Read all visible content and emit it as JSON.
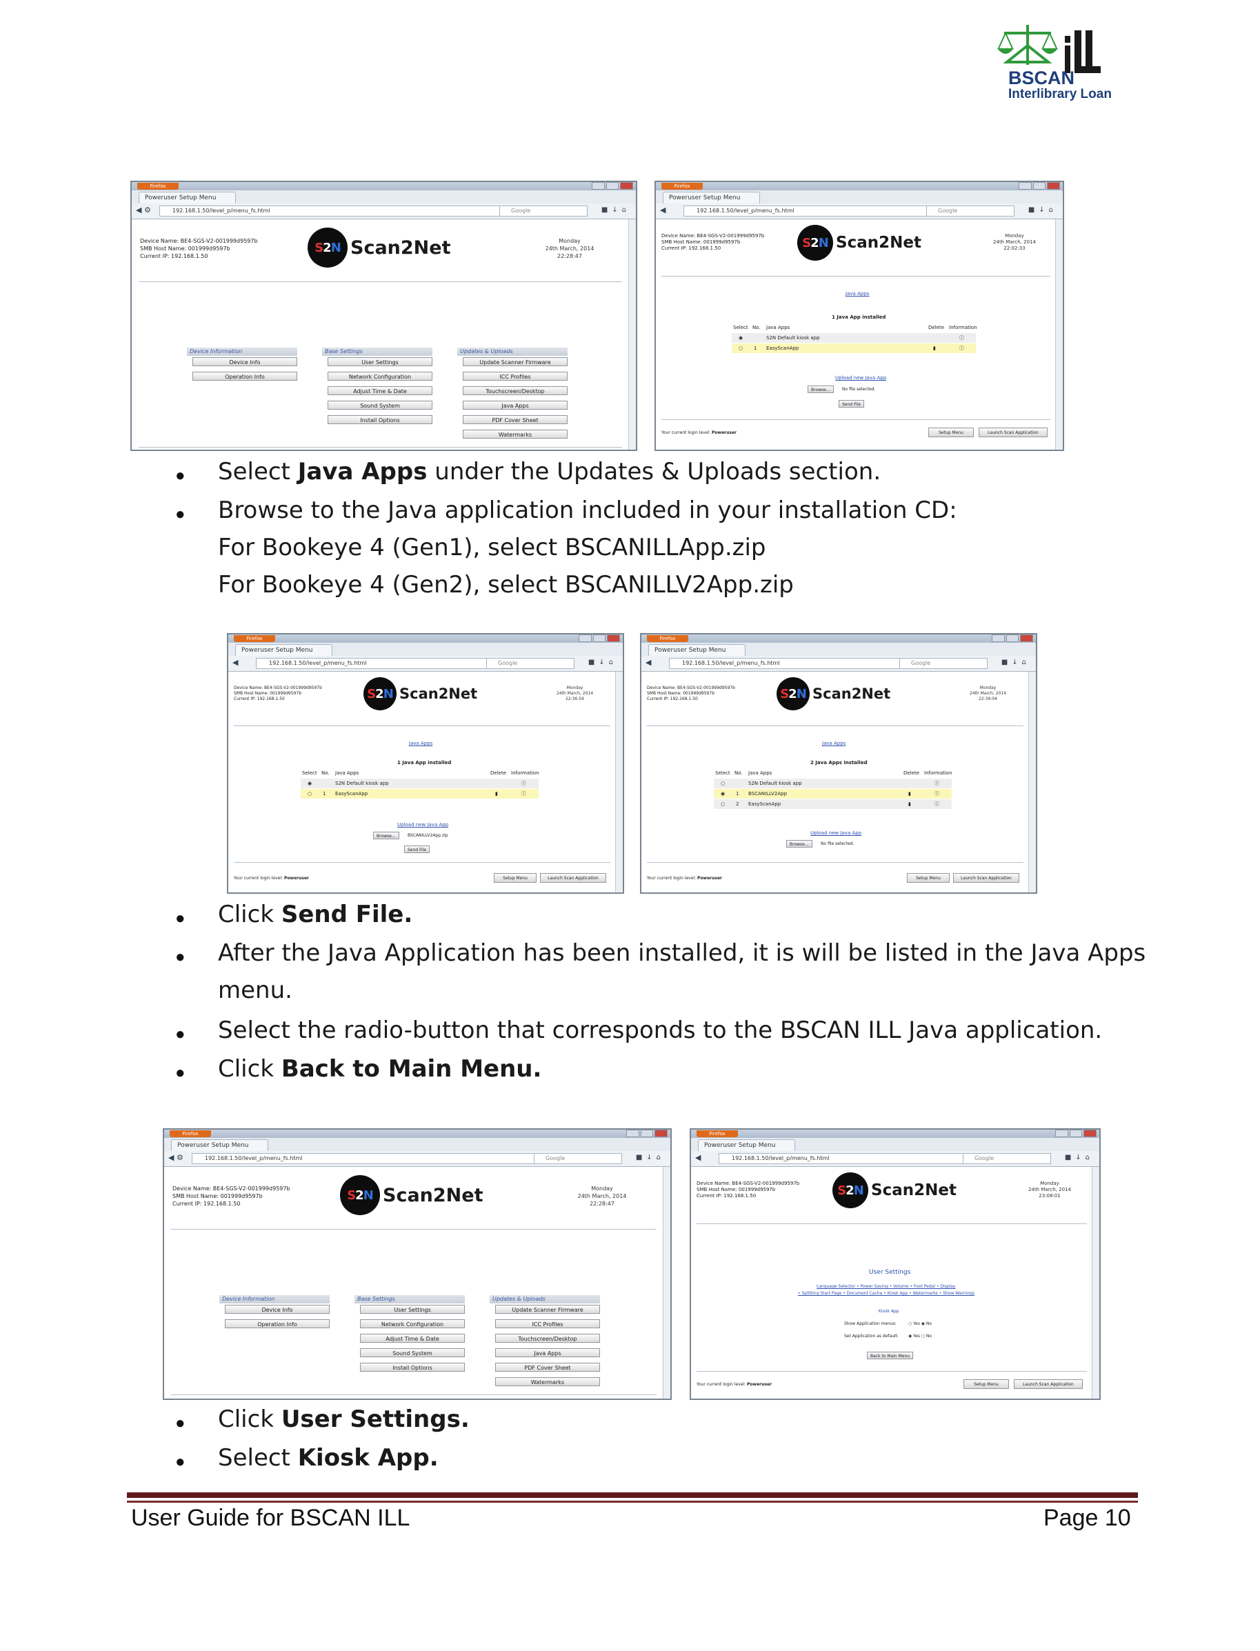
{
  "logo": {
    "brand": "BSCAN",
    "ill": "iLL",
    "subtitle": "Interlibrary Loan"
  },
  "browser": {
    "app_button": "Firefox",
    "tab_label": "Poweruser Setup Menu",
    "url_menu": "192.168.1.50/level_p/menu_fs.html",
    "url_java": "192.168.1.50/level_p/menu_fs.html",
    "search_placeholder": "Google"
  },
  "device": {
    "name_line": "Device Name: BE4-SGS-V2-001999d9597b",
    "host_line": "SMB Host Name: 001999d9597b",
    "ip_line": "Current IP: 192.168.1.50",
    "day": "Monday",
    "date": "24th March, 2014",
    "time_menu": "22:28:47",
    "time_java1": "22:02:33",
    "time_java2": "22:36:59",
    "time_java3": "22:39:04",
    "time_user": "23:08:01"
  },
  "brand": {
    "badge": "S2N",
    "name": "Scan2Net"
  },
  "menu": {
    "sections": [
      {
        "title": "Device Information",
        "buttons": [
          "Device Info",
          "Operation Info"
        ]
      },
      {
        "title": "Base Settings",
        "buttons": [
          "User Settings",
          "Network Configuration",
          "Adjust Time & Date",
          "Sound System",
          "Install Options"
        ]
      },
      {
        "title": "Updates & Uploads",
        "buttons": [
          "Update Scanner Firmware",
          "ICC Profiles",
          "Touchscreen/Desktop",
          "Java Apps",
          "PDF Cover Sheet",
          "Watermarks"
        ]
      }
    ]
  },
  "footer_bar": {
    "login_label": "Your current login level:",
    "login_level": "Poweruser",
    "setup_menu": "Setup Menu",
    "launch": "Launch Scan Application"
  },
  "java": {
    "title": "Java Apps",
    "installed_one": "1 Java App installed",
    "installed_two": "2 Java Apps installed",
    "headers": {
      "select": "Select",
      "no": "No.",
      "apps": "Java Apps",
      "delete": "Delete",
      "info": "Information"
    },
    "default_app": "S2N Default kiosk app",
    "easy_app": "EasyScanApp",
    "bscan_app": "BSCANILLV2App",
    "upload_link": "Upload new Java App",
    "browse": "Browse...",
    "no_file": "No file selected.",
    "selected_file": "BSCANILLV2App.zip",
    "send_file": "Send File",
    "row_no_1": "1",
    "row_no_2": "2"
  },
  "user_settings": {
    "title": "User Settings",
    "links1": "Language Selector • Power Saving • Volume • Foot Pedal • Display",
    "links2": "• Splitting Start Page • Document Cache • Kiosk App • Watermarks • Show Warnings",
    "kiosk_title": "Kiosk App",
    "show_menus": "Show Application menus:",
    "set_default": "Set Application as default:",
    "yes": "Yes",
    "no": "No",
    "back": "Back to Main Menu"
  },
  "steps": {
    "s1_pre": "Select ",
    "s1_bold": "Java Apps",
    "s1_post": " under the Updates & Uploads section.",
    "s2": "Browse to the Java application included in your installation CD:",
    "s2a": "For Bookeye 4 (Gen1), select BSCANILLApp.zip",
    "s2b": "For Bookeye 4 (Gen2), select BSCANILLV2App.zip",
    "s3_pre": "Click ",
    "s3_bold": "Send File.",
    "s4a": "After the Java Application has been installed, it is will be listed in the Java Apps",
    "s4b": "menu.",
    "s5": "Select the radio-button that corresponds to the BSCAN ILL Java application.",
    "s6_pre": "Click ",
    "s6_bold": "Back to Main Menu.",
    "s7_pre": "Click ",
    "s7_bold": "User Settings.",
    "s8_pre": "Select ",
    "s8_bold": "Kiosk App."
  },
  "page_footer": {
    "left": "User Guide for BSCAN ILL",
    "right": "Page 10"
  },
  "colors": {
    "rule": "#5e1a1a",
    "logo_green": "#2f9a3a",
    "logo_blue": "#1f3f7a",
    "link_blue": "#2a4fb0",
    "highlight": "#fbf7b8"
  }
}
